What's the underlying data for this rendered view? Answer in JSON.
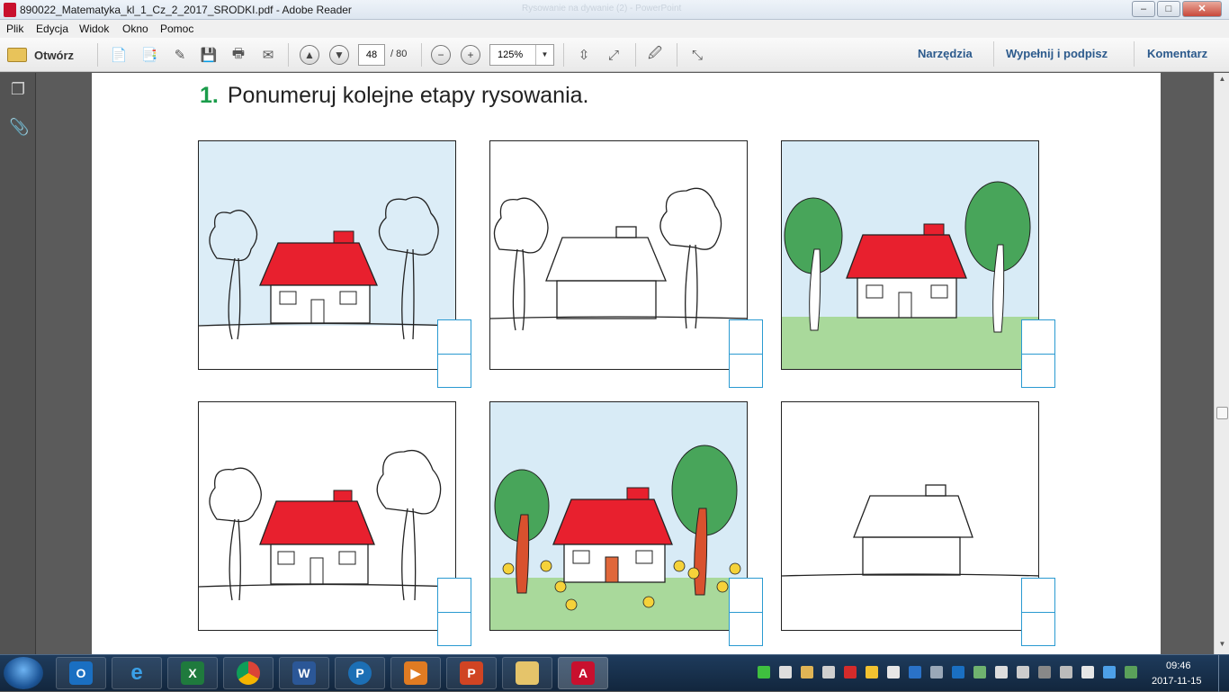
{
  "window": {
    "title": "890022_Matematyka_kl_1_Cz_2_2017_SRODKI.pdf - Adobe Reader",
    "background_title": "Rysowanie na dywanie (2) - PowerPoint",
    "controls": {
      "minimize": "–",
      "maximize": "□",
      "close": "✕"
    }
  },
  "menu": [
    "Plik",
    "Edycja",
    "Widok",
    "Okno",
    "Pomoc"
  ],
  "toolbar": {
    "open_label": "Otwórz",
    "page_current": "48",
    "page_total": "/ 80",
    "zoom": "125%",
    "right_links": [
      "Narzędzia",
      "Wypełnij i podpisz",
      "Komentarz"
    ]
  },
  "document": {
    "exercise_number": "1.",
    "exercise_text": "Ponumeruj kolejne etapy rysowania.",
    "cards": [
      {
        "stage": "red roof, outlined trees, blue sky"
      },
      {
        "stage": "outline house with trees"
      },
      {
        "stage": "colored trees, red roof, green grass, sky"
      },
      {
        "stage": "red roof, outlined trees"
      },
      {
        "stage": "fully colored with flowers"
      },
      {
        "stage": "house outline only"
      }
    ]
  },
  "taskbar": {
    "apps": [
      "Outlook",
      "Internet Explorer",
      "Excel",
      "Chrome",
      "Word",
      "Pandora",
      "Media",
      "PowerPoint",
      "Explorer",
      "Adobe Reader"
    ],
    "clock_time": "09:46",
    "clock_date": "2017-11-15"
  },
  "colors": {
    "accent_green": "#1a9c4a",
    "numbox_blue": "#2a9ad1",
    "roof_red": "#e8202e",
    "link_blue": "#2c5a8c"
  }
}
